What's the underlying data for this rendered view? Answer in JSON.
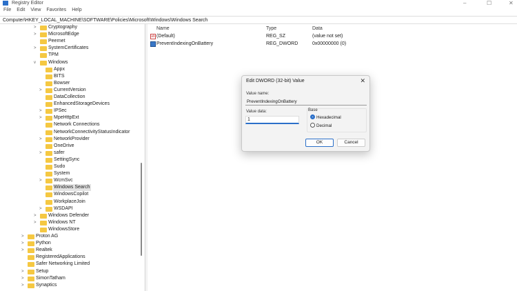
{
  "window": {
    "title": "Registry Editor",
    "min": "–",
    "max": "☐",
    "close": "✕"
  },
  "menu": [
    "File",
    "Edit",
    "View",
    "Favorites",
    "Help"
  ],
  "address": "Computer\\HKEY_LOCAL_MACHINE\\SOFTWARE\\Policies\\Microsoft\\Windows\\Windows Search",
  "tree": [
    {
      "label": "Cryptography",
      "level": 2,
      "chevron": ">"
    },
    {
      "label": "MicrosoftEdge",
      "level": 2,
      "chevron": ">"
    },
    {
      "label": "Peernet",
      "level": 2,
      "chevron": ""
    },
    {
      "label": "SystemCertificates",
      "level": 2,
      "chevron": ">"
    },
    {
      "label": "TPM",
      "level": 2,
      "chevron": ""
    },
    {
      "label": "Windows",
      "level": 2,
      "chevron": "v"
    },
    {
      "label": "Appx",
      "level": 3,
      "chevron": ""
    },
    {
      "label": "BITS",
      "level": 3,
      "chevron": ""
    },
    {
      "label": "Bowser",
      "level": 3,
      "chevron": ""
    },
    {
      "label": "CurrentVersion",
      "level": 3,
      "chevron": ">"
    },
    {
      "label": "DataCollection",
      "level": 3,
      "chevron": ""
    },
    {
      "label": "EnhancedStorageDevices",
      "level": 3,
      "chevron": ""
    },
    {
      "label": "IPSec",
      "level": 3,
      "chevron": ">"
    },
    {
      "label": "MpeHttpExt",
      "level": 3,
      "chevron": ">"
    },
    {
      "label": "Network Connections",
      "level": 3,
      "chevron": ""
    },
    {
      "label": "NetworkConnectivityStatusIndicator",
      "level": 3,
      "chevron": ""
    },
    {
      "label": "NetworkProvider",
      "level": 3,
      "chevron": ">"
    },
    {
      "label": "OneDrive",
      "level": 3,
      "chevron": ""
    },
    {
      "label": "safer",
      "level": 3,
      "chevron": ">"
    },
    {
      "label": "SettingSync",
      "level": 3,
      "chevron": ""
    },
    {
      "label": "Sudo",
      "level": 3,
      "chevron": ""
    },
    {
      "label": "System",
      "level": 3,
      "chevron": ""
    },
    {
      "label": "WcmSvc",
      "level": 3,
      "chevron": ">"
    },
    {
      "label": "Windows Search",
      "level": 3,
      "chevron": "",
      "selected": true
    },
    {
      "label": "WindowsCopilot",
      "level": 3,
      "chevron": ""
    },
    {
      "label": "WorkplaceJoin",
      "level": 3,
      "chevron": ""
    },
    {
      "label": "WSDAPI",
      "level": 3,
      "chevron": ">"
    },
    {
      "label": "Windows Defender",
      "level": 2,
      "chevron": ">"
    },
    {
      "label": "Windows NT",
      "level": 2,
      "chevron": ">"
    },
    {
      "label": "WindowsStore",
      "level": 2,
      "chevron": ""
    },
    {
      "label": "Proton AG",
      "level": 1,
      "chevron": ">"
    },
    {
      "label": "Python",
      "level": 1,
      "chevron": ">"
    },
    {
      "label": "Realtek",
      "level": 1,
      "chevron": ">"
    },
    {
      "label": "RegisteredApplications",
      "level": 1,
      "chevron": ""
    },
    {
      "label": "Safer Networking Limited",
      "level": 1,
      "chevron": ""
    },
    {
      "label": "Setup",
      "level": 1,
      "chevron": ">"
    },
    {
      "label": "SimonTatham",
      "level": 1,
      "chevron": ">"
    },
    {
      "label": "Synaptics",
      "level": 1,
      "chevron": ">"
    }
  ],
  "list": {
    "headers": {
      "name": "Name",
      "type": "Type",
      "data": "Data"
    },
    "rows": [
      {
        "name": "(Default)",
        "type": "REG_SZ",
        "data": "(value not set)",
        "icon": "string-value-icon"
      },
      {
        "name": "PreventIndexingOnBattery",
        "type": "REG_DWORD",
        "data": "0x00000000 (0)",
        "icon": "dword-value-icon"
      }
    ]
  },
  "dialog": {
    "title": "Edit DWORD (32-bit) Value",
    "close": "✕",
    "value_name_label": "Value name:",
    "value_name": "PreventIndexingOnBattery",
    "value_data_label": "Value data:",
    "value_data": "1",
    "base_label": "Base",
    "hex_label": "Hexadecimal",
    "dec_label": "Decimal",
    "base_selected": "Hexadecimal",
    "ok": "OK",
    "cancel": "Cancel"
  },
  "colors": {
    "accent": "#2a6fc9",
    "folder": "#f5c842"
  }
}
